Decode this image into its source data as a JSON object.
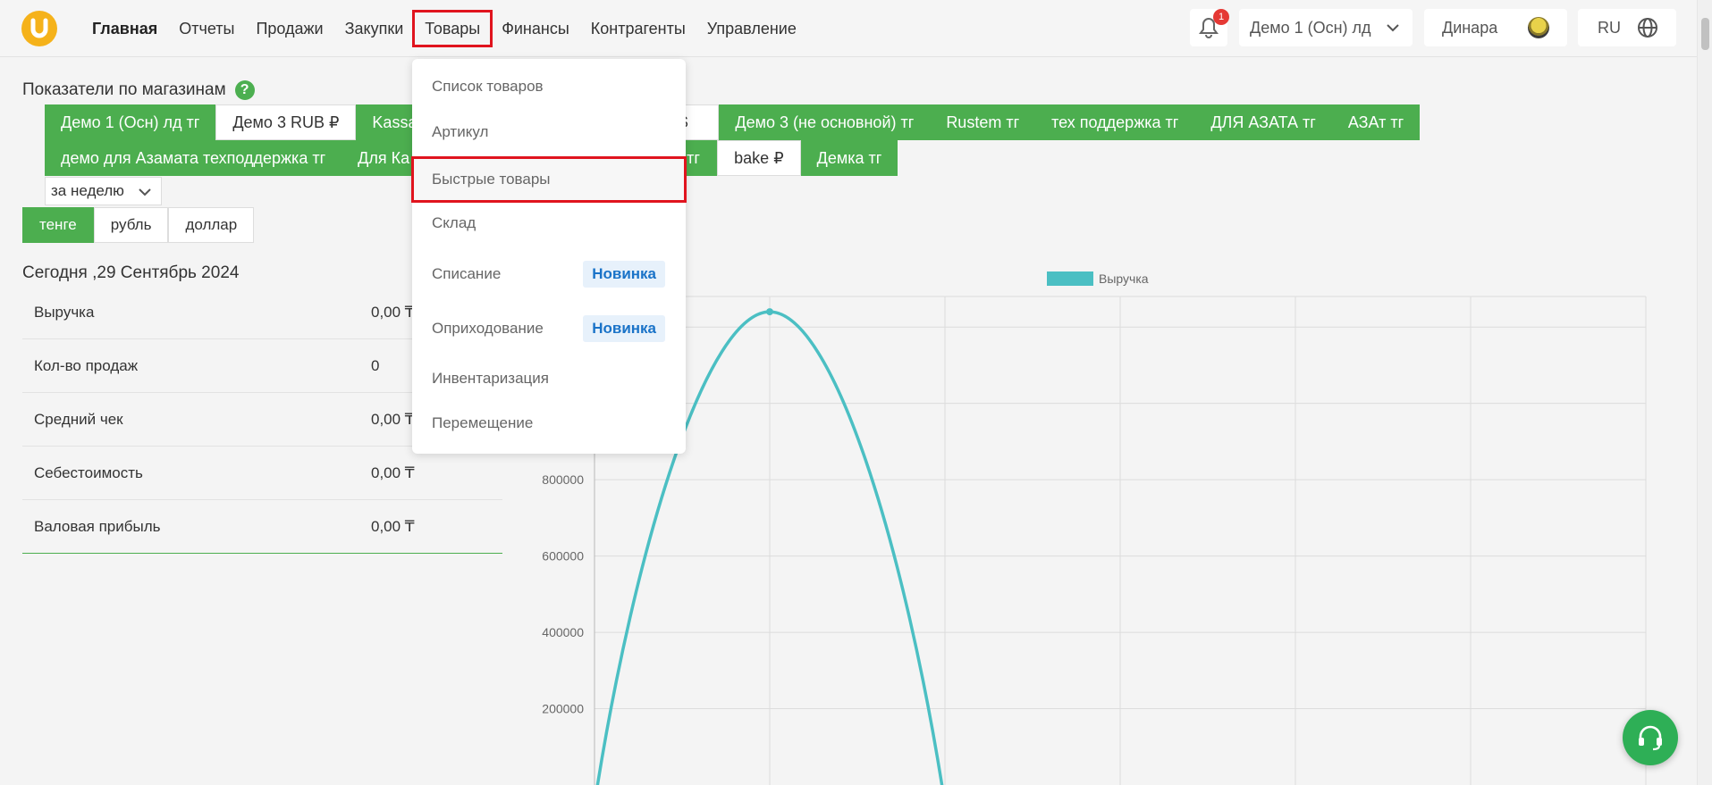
{
  "nav": {
    "items": [
      "Главная",
      "Отчеты",
      "Продажи",
      "Закупки",
      "Товары",
      "Финансы",
      "Контрагенты",
      "Управление"
    ]
  },
  "header": {
    "notification_count": "1",
    "store_selected": "Демо 1 (Осн) лд",
    "user_name": "Динара",
    "language": "RU"
  },
  "page": {
    "section_title": "Показатели по магазинам",
    "period": "за неделю",
    "date_title": "Сегодня ,29 Сентябрь 2024"
  },
  "store_tabs": {
    "row1": [
      "Демо 1 (Осн) лд тг",
      "Демо 3 RUB ₽",
      "Kassa",
      "sd $",
      "Демо 3 (не основной) тг",
      "Rustem тг",
      "тех поддержка тг",
      "ДЛЯ АЗАТА тг",
      "АЗАт тг"
    ],
    "row2": [
      "демо для Азамата техподдержка тг",
      "Для Ка",
      "тг",
      "bake ₽",
      "Демка тг"
    ]
  },
  "currency": [
    "тенге",
    "рубль",
    "доллар"
  ],
  "stats": [
    {
      "label": "Выручка",
      "value": "0,00 ₸"
    },
    {
      "label": "Кол-во продаж",
      "value": "0"
    },
    {
      "label": "Средний чек",
      "value": "0,00 ₸"
    },
    {
      "label": "Себестоимость",
      "value": "0,00 ₸"
    },
    {
      "label": "Валовая прибыль",
      "value": "0,00 ₸"
    }
  ],
  "dropdown": {
    "items": [
      "Список товаров",
      "Артикул",
      "Быстрые товары",
      "Склад",
      "Списание",
      "Оприходование",
      "Инвентаризация",
      "Перемещение"
    ],
    "badge": "Новинка"
  },
  "colors": {
    "accent": "#4cae4f",
    "chart_line": "#4bbfc3",
    "highlight": "#e0141e"
  },
  "chart_data": {
    "type": "line",
    "legend": [
      "Выручка"
    ],
    "y_ticks": [
      "800000",
      "600000",
      "400000",
      "200000"
    ],
    "series": [
      {
        "name": "Выручка",
        "x": [
          0,
          1,
          2,
          3,
          4,
          5,
          6
        ],
        "values": [
          -50000,
          1240000,
          -50000,
          null,
          null,
          null,
          null
        ]
      }
    ],
    "ylim": [
      0,
      1280000
    ],
    "grid": true,
    "legend_position": "top"
  }
}
